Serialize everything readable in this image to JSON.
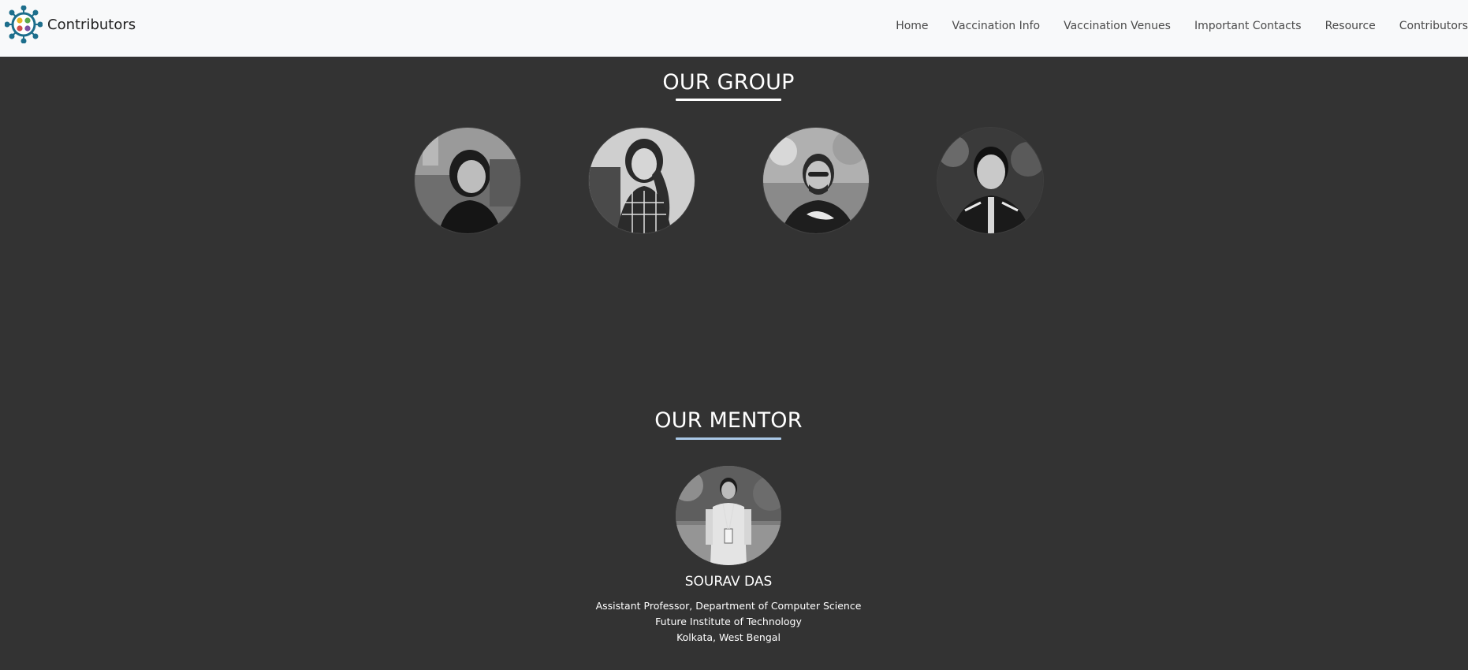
{
  "brand": {
    "title": "Contributors",
    "logo_icon": "virus-logo-icon"
  },
  "nav": {
    "links": [
      "Home",
      "Vaccination Info",
      "Vaccination Venues",
      "Important Contacts",
      "Resource",
      "Contributors"
    ]
  },
  "group": {
    "title": "OUR GROUP",
    "underline_color": "#ffffff",
    "members": [
      {
        "photo": "member-photo-1"
      },
      {
        "photo": "member-photo-2"
      },
      {
        "photo": "member-photo-3"
      },
      {
        "photo": "member-photo-4"
      }
    ]
  },
  "mentor": {
    "title": "OUR MENTOR",
    "underline_color": "#a9c7e6",
    "name": "SOURAV DAS",
    "lines": [
      "Assistant Professor, Department of Computer Science",
      "Future Institute of Technology",
      "Kolkata, West Bengal"
    ]
  },
  "colors": {
    "background": "#333333",
    "navbar": "#f8f9fa"
  }
}
